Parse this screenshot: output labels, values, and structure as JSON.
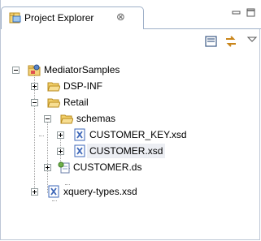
{
  "view": {
    "title": "Project Explorer",
    "close_glyph": "⊗"
  },
  "tree": {
    "root": {
      "label": "MediatorSamples",
      "icon": "project-icon"
    },
    "items": [
      {
        "label": "DSP-INF",
        "icon": "folder-icon"
      },
      {
        "label": "Retail",
        "icon": "folder-icon"
      },
      {
        "label": "schemas",
        "icon": "folder-icon"
      },
      {
        "label": "CUSTOMER_KEY.xsd",
        "icon": "xsd-file-icon"
      },
      {
        "label": "CUSTOMER.xsd",
        "icon": "xsd-file-icon",
        "selected": true
      },
      {
        "label": "CUSTOMER.ds",
        "icon": "data-service-icon"
      },
      {
        "label": "xquery-types.xsd",
        "icon": "xsd-file-icon"
      }
    ]
  },
  "colors": {
    "folder": "#f2d06b",
    "xsd": "#3e67b8",
    "selection": "#eceef3"
  }
}
